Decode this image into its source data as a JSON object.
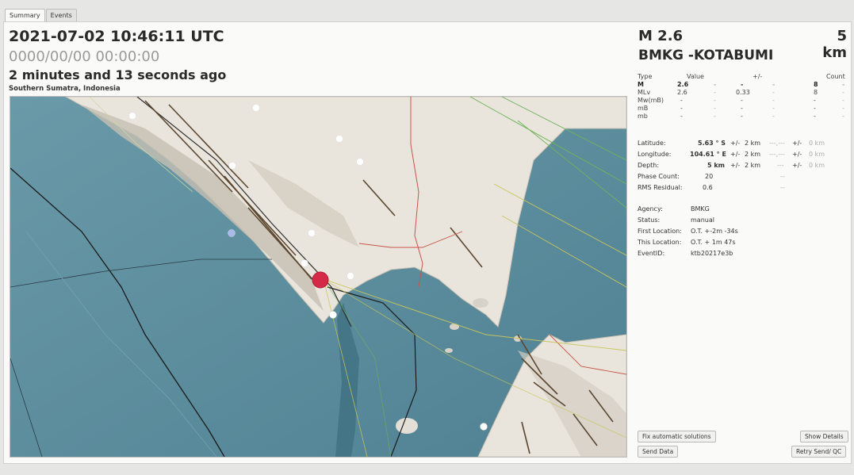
{
  "tabs": [
    {
      "label": "Summary"
    },
    {
      "label": "Events"
    }
  ],
  "summary": {
    "origin_time": "2021-07-02 10:46:11 UTC",
    "zero_time": "0000/00/00  00:00:00",
    "time_ago": "2 minutes and 13 seconds ago",
    "region": "Southern Sumatra, Indonesia",
    "magnitude": "M 2.6",
    "depth": "5 km",
    "agency_region": "BMKG -KOTABUMI"
  },
  "magnitude_table": {
    "headers": {
      "type": "Type",
      "value": "Value",
      "pm": "+/-",
      "count": "Count"
    },
    "rows": [
      {
        "type": "M",
        "value": "2.6",
        "d1": "-",
        "d2": "-",
        "d3": "-",
        "count": "8",
        "d4": "-"
      },
      {
        "type": "MLv",
        "value": "2.6",
        "d1": "-",
        "d2": "0.33",
        "d3": "-",
        "count": "8",
        "d4": "-"
      },
      {
        "type": "Mw(mB)",
        "value": "-",
        "d1": "-",
        "d2": "-",
        "d3": "-",
        "count": "-",
        "d4": "-"
      },
      {
        "type": "mB",
        "value": "-",
        "d1": "-",
        "d2": "-",
        "d3": "-",
        "count": "-",
        "d4": "-"
      },
      {
        "type": "mb",
        "value": "-",
        "d1": "-",
        "d2": "-",
        "d3": "-",
        "count": "-",
        "d4": "-"
      }
    ]
  },
  "location": {
    "latitude_label": "Latitude:",
    "latitude_value": "5.63 ° S",
    "latitude_pm": "+/-",
    "latitude_unc": "2 km",
    "latitude_dash": "---,---",
    "latitude_pm2": "+/-",
    "latitude_unc2": "0 km",
    "longitude_label": "Longitude:",
    "longitude_value": "104.61 ° E",
    "longitude_pm": "+/-",
    "longitude_unc": "2 km",
    "longitude_dash": "---,---",
    "longitude_pm2": "+/-",
    "longitude_unc2": "0 km",
    "depth_label": "Depth:",
    "depth_value": "5 km",
    "depth_pm": "+/-",
    "depth_unc": "2 km",
    "depth_dash": "---",
    "depth_pm2": "+/-",
    "depth_unc2": "0 km",
    "phase_label": "Phase Count:",
    "phase_value": "20",
    "phase_dash": "--",
    "rms_label": "RMS Residual:",
    "rms_value": "0.6",
    "rms_dash": "--"
  },
  "event_info": {
    "agency_label": "Agency:",
    "agency_value": "BMKG",
    "status_label": "Status:",
    "status_value": "manual",
    "first_label": "First Location:",
    "first_value": "O.T. +-2m -34s",
    "this_label": "This Location:",
    "this_value": "O.T. + 1m 47s",
    "eventid_label": "EventID:",
    "eventid_value": "ktb20217e3b"
  },
  "buttons": {
    "fix": "Fix automatic solutions",
    "show": "Show Details",
    "send": "Send Data",
    "retry": "Retry Send/ QC"
  },
  "map": {
    "sea_color": "#5f8f9f",
    "land_color": "#e8e4dc",
    "epicenter_color": "#d42a48"
  }
}
